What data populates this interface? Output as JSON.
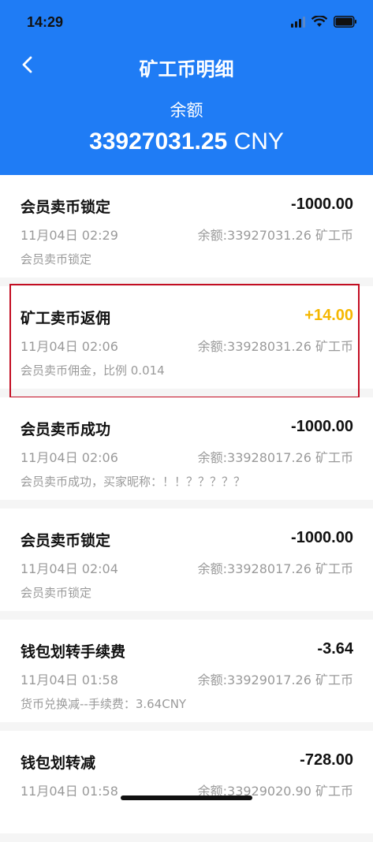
{
  "status": {
    "time": "14:29"
  },
  "nav": {
    "title": "矿工币明细"
  },
  "balance": {
    "label": "余额",
    "value": "33927031.25",
    "currency": "CNY"
  },
  "records": [
    {
      "title": "会员卖币锁定",
      "amount": "-1000.00",
      "date": "11月04日 02:29",
      "balance": "余额:33927031.26 矿工币",
      "desc": "会员卖币锁定"
    },
    {
      "title": "矿工卖币返佣",
      "amount": "+14.00",
      "date": "11月04日 02:06",
      "balance": "余额:33928031.26 矿工币",
      "desc": "会员卖币佣金，比例 0.014"
    },
    {
      "title": "会员卖币成功",
      "amount": "-1000.00",
      "date": "11月04日 02:06",
      "balance": "余额:33928017.26 矿工币",
      "desc": "会员卖币成功，买家昵称：！！？？？？？"
    },
    {
      "title": "会员卖币锁定",
      "amount": "-1000.00",
      "date": "11月04日 02:04",
      "balance": "余额:33928017.26 矿工币",
      "desc": "会员卖币锁定"
    },
    {
      "title": "钱包划转手续费",
      "amount": "-3.64",
      "date": "11月04日 01:58",
      "balance": "余额:33929017.26 矿工币",
      "desc": "货币兑换减--手续费：3.64CNY"
    },
    {
      "title": "钱包划转减",
      "amount": "-728.00",
      "date": "11月04日 01:58",
      "balance": "余额:33929020.90 矿工币",
      "desc": ""
    }
  ],
  "colors": {
    "header": "#1f7cf5",
    "positive": "#f5b700",
    "highlight_border": "#c30d22"
  }
}
